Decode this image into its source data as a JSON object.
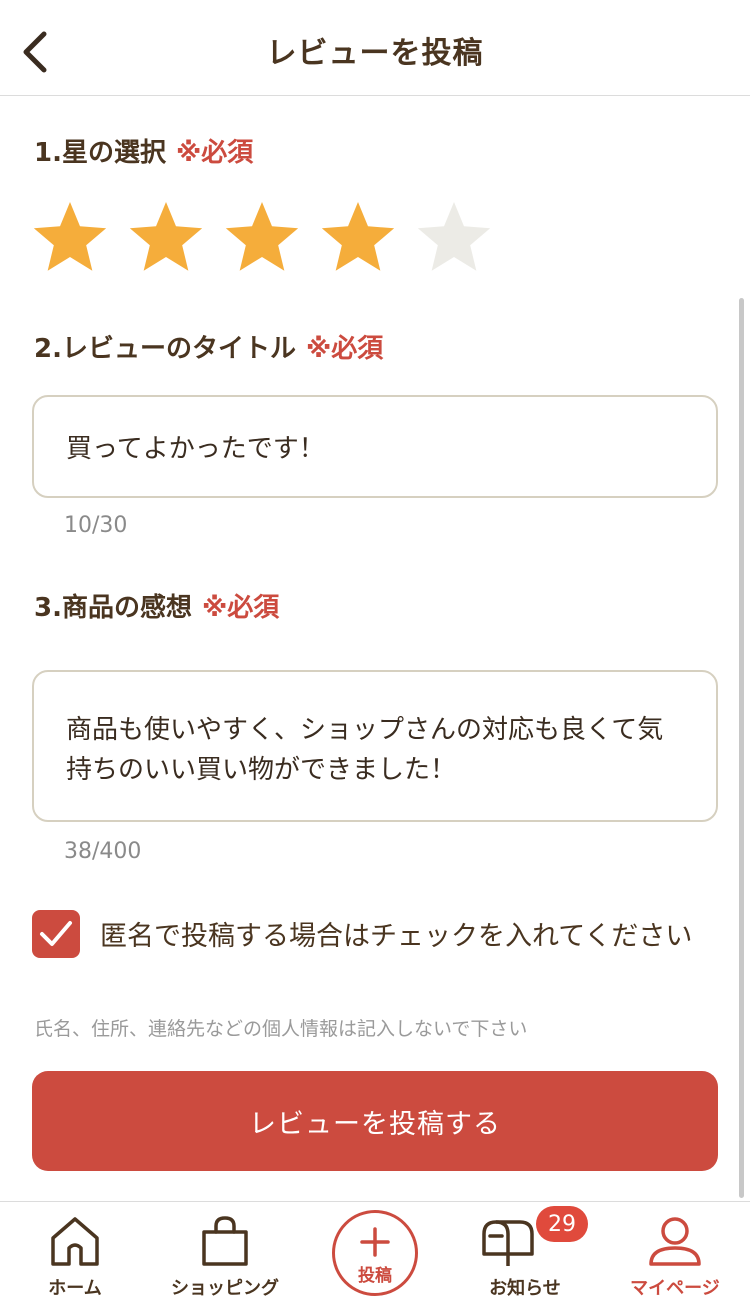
{
  "header": {
    "title": "レビューを投稿"
  },
  "rating": {
    "label": "1.星の選択",
    "required": "※必須",
    "value": 4,
    "max": 5,
    "filled_color": "#F5AD3B",
    "empty_color": "#ECEBE6"
  },
  "review_title": {
    "label": "2.レビューのタイトル",
    "required": "※必須",
    "value": "買ってよかったです！",
    "counter": "10/30"
  },
  "review_comment": {
    "label": "3.商品の感想",
    "required": "※必須",
    "value": "商品も使いやすく、ショップさんの対応も良くて気持ちのいい買い物ができました！",
    "counter": "38/400"
  },
  "anonymous": {
    "checked": true,
    "label": "匿名で投稿する場合はチェックを入れてください"
  },
  "notice": "氏名、住所、連絡先などの個人情報は記入しないで下さい",
  "submit_label": "レビューを投稿する",
  "accent_color": "#CC4B3F",
  "tabbar": {
    "home": "ホーム",
    "shopping": "ショッピング",
    "post": "投稿",
    "notifications": "お知らせ",
    "notifications_badge": "29",
    "mypage": "マイページ",
    "active": "mypage"
  }
}
